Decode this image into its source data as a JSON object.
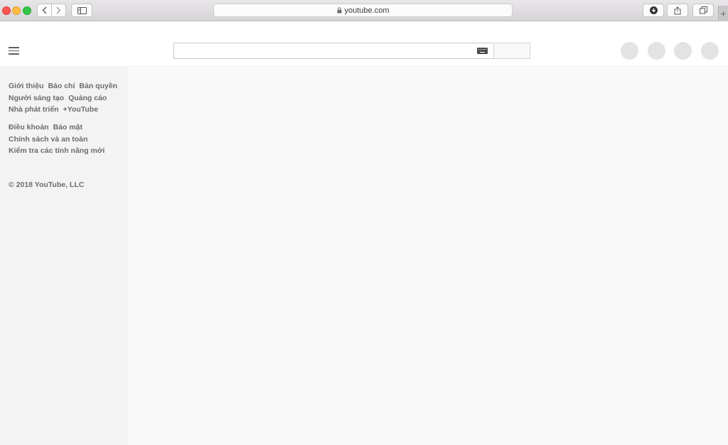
{
  "browser": {
    "address": "youtube.com",
    "new_tab_symbol": "+"
  },
  "header": {
    "search": {
      "value": "",
      "placeholder": ""
    }
  },
  "guide": {
    "primary_links": [
      [
        "Giới thiệu",
        "Báo chí",
        "Bản quyền"
      ],
      [
        "Người sáng tạo",
        "Quảng cáo"
      ],
      [
        "Nhà phát triển",
        "+YouTube"
      ]
    ],
    "secondary_links": [
      [
        "Điều khoản",
        "Bảo mật"
      ],
      [
        "Chính sách và an toàn"
      ],
      [
        "Kiểm tra các tính năng mới"
      ]
    ],
    "copyright": "© 2018 YouTube, LLC"
  },
  "colors": {
    "header_bg": "#ffffff",
    "guide_bg": "#f4f3f4",
    "content_bg": "#f9f9f9",
    "placeholder_circle": "#e3e3e3"
  }
}
